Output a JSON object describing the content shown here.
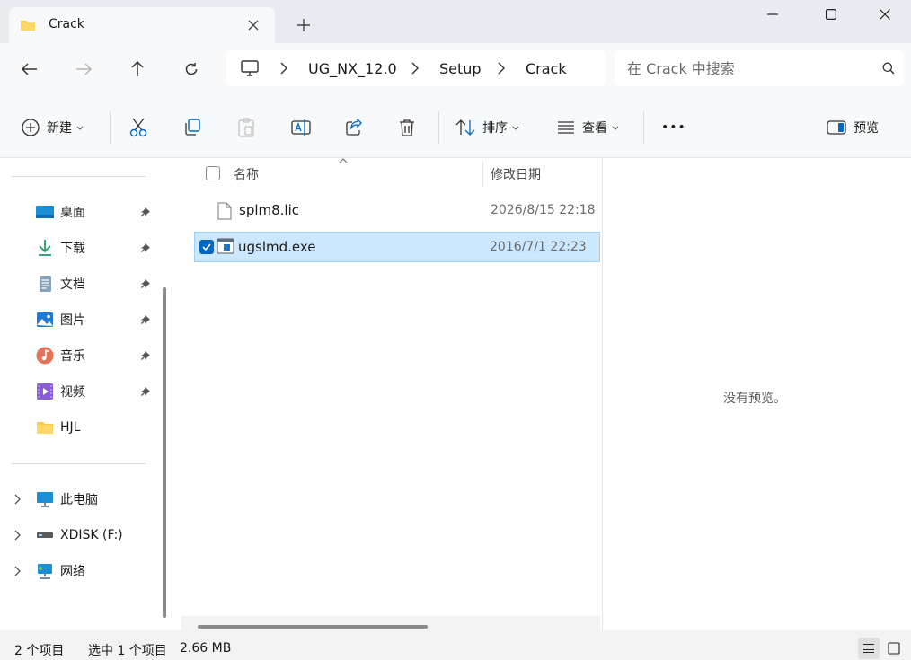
{
  "window": {
    "tab_title": "Crack",
    "icons": {
      "tab": "folder-icon",
      "close_tab": "close-icon",
      "new_tab": "plus-icon",
      "minimize": "minimize-icon",
      "maximize": "maximize-icon",
      "close": "close-icon"
    }
  },
  "address": {
    "breadcrumbs": [
      "UG_NX_12.0",
      "Setup",
      "Crack"
    ],
    "search_placeholder": "在 Crack 中搜索"
  },
  "toolbar": {
    "new_label": "新建",
    "sort_label": "排序",
    "view_label": "查看",
    "more_label": "•••",
    "preview_label": "预览"
  },
  "sidebar": {
    "quick_access": [
      {
        "label": "桌面",
        "icon": "desktop-icon",
        "pinned": true
      },
      {
        "label": "下载",
        "icon": "download-icon",
        "pinned": true
      },
      {
        "label": "文档",
        "icon": "document-icon",
        "pinned": true
      },
      {
        "label": "图片",
        "icon": "picture-icon",
        "pinned": true
      },
      {
        "label": "音乐",
        "icon": "music-icon",
        "pinned": true
      },
      {
        "label": "视频",
        "icon": "video-icon",
        "pinned": true
      },
      {
        "label": "HJL",
        "icon": "folder-icon",
        "pinned": false
      }
    ],
    "locations": [
      {
        "label": "此电脑",
        "icon": "computer-icon"
      },
      {
        "label": "XDISK (F:)",
        "icon": "drive-icon"
      },
      {
        "label": "网络",
        "icon": "network-icon"
      }
    ]
  },
  "file_list": {
    "columns": [
      "名称",
      "修改日期"
    ],
    "rows": [
      {
        "name": "splm8.lic",
        "modified": "2026/8/15 22:18",
        "selected": false,
        "icon": "file-icon"
      },
      {
        "name": "ugslmd.exe",
        "modified": "2016/7/1 22:23",
        "selected": true,
        "icon": "executable-icon"
      }
    ]
  },
  "preview": {
    "empty_text": "没有预览。"
  },
  "status": {
    "item_count": "2 个项目",
    "selection": "选中 1 个项目",
    "selection_size": "2.66 MB"
  },
  "colors": {
    "accent": "#0067c0",
    "selection_bg": "#cce8ff",
    "selection_border": "#99d1ff",
    "folder_yellow": "#ffc83d"
  }
}
